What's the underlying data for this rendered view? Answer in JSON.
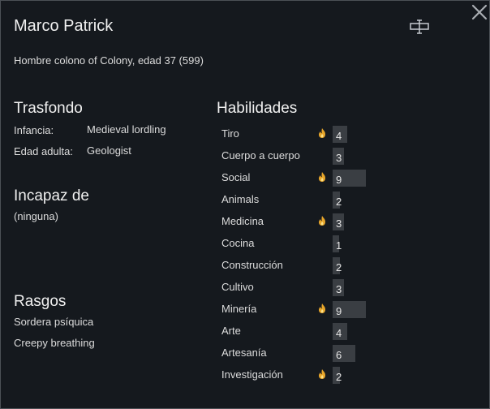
{
  "pawn": {
    "name": "Marco Patrick",
    "description": "Hombre colono of Colony, edad 37 (599)"
  },
  "icons": {
    "close": "close-icon",
    "rename": "rename-icon",
    "passion": "flame-icon"
  },
  "backstory": {
    "title": "Trasfondo",
    "childhood_label": "Infancia:",
    "childhood_value": "Medieval lordling",
    "adulthood_label": "Edad adulta:",
    "adulthood_value": "Geologist"
  },
  "incapable": {
    "title": "Incapaz de",
    "value": "(ninguna)"
  },
  "traits": {
    "title": "Rasgos",
    "items": [
      "Sordera psíquica",
      "Creepy breathing"
    ]
  },
  "skills": {
    "title": "Habilidades",
    "max_level": 20,
    "items": [
      {
        "name": "Tiro",
        "level": "4",
        "passion": true
      },
      {
        "name": "Cuerpo a cuerpo",
        "level": "3",
        "passion": false
      },
      {
        "name": "Social",
        "level": "9",
        "passion": true
      },
      {
        "name": "Animals",
        "level": "2",
        "passion": false
      },
      {
        "name": "Medicina",
        "level": "3",
        "passion": true
      },
      {
        "name": "Cocina",
        "level": "1",
        "passion": false
      },
      {
        "name": "Construcción",
        "level": "2",
        "passion": false
      },
      {
        "name": "Cultivo",
        "level": "3",
        "passion": false
      },
      {
        "name": "Minería",
        "level": "9",
        "passion": true
      },
      {
        "name": "Arte",
        "level": "4",
        "passion": false
      },
      {
        "name": "Artesanía",
        "level": "6",
        "passion": false
      },
      {
        "name": "Investigación",
        "level": "2",
        "passion": true
      }
    ]
  }
}
